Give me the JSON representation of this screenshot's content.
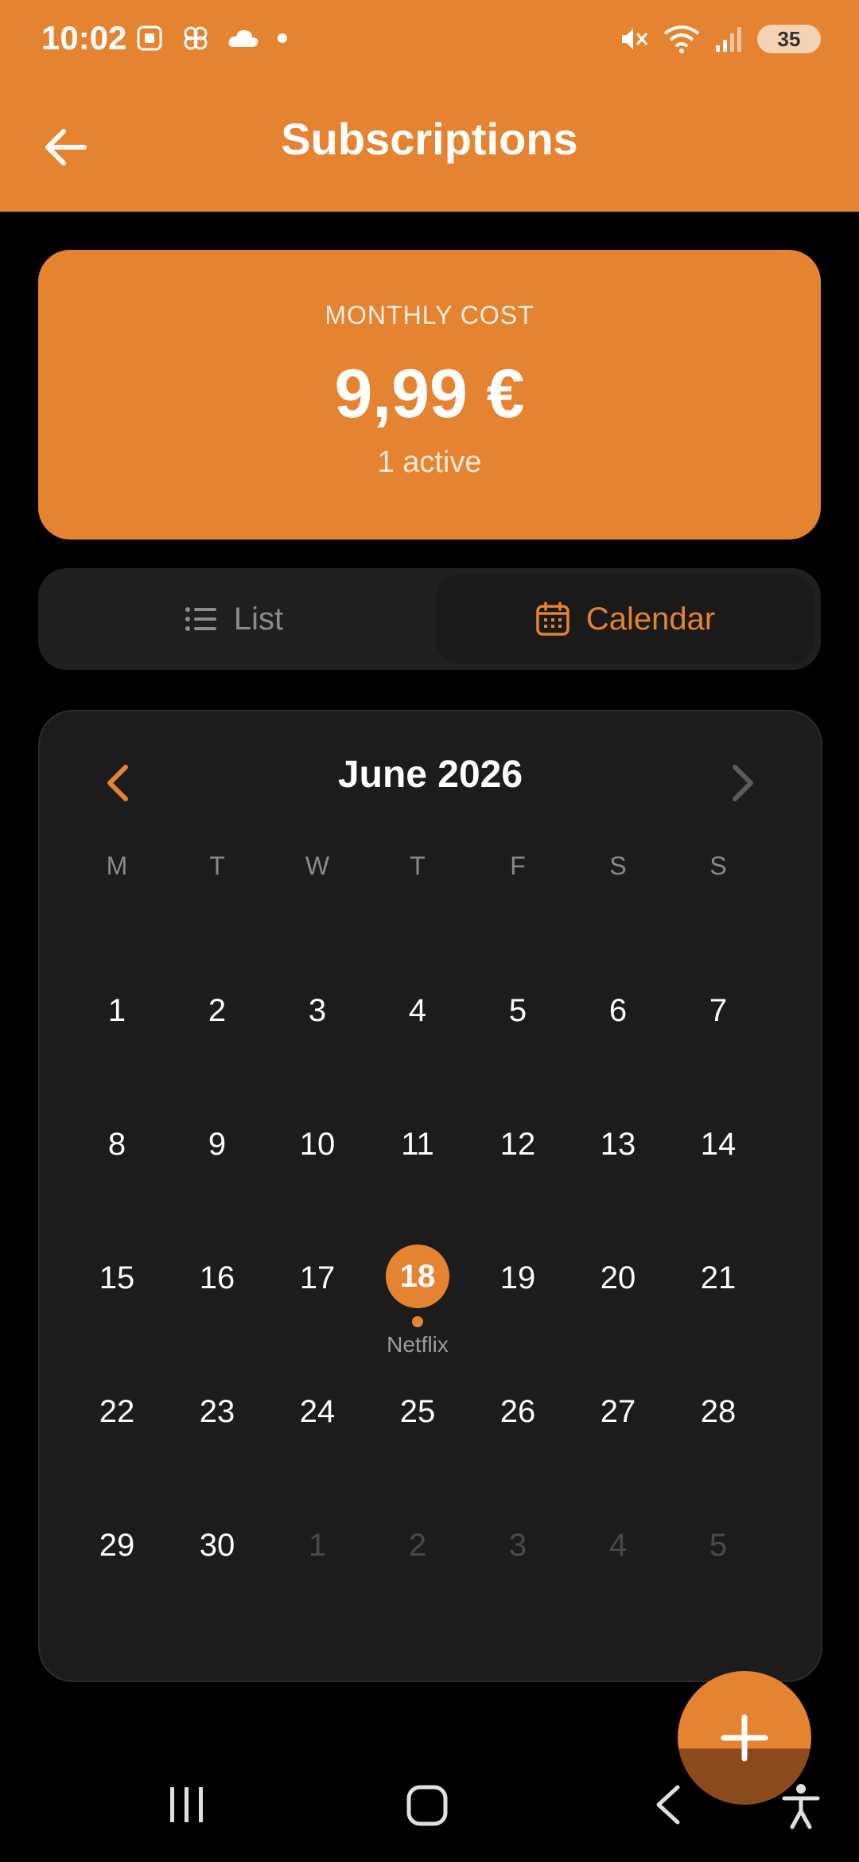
{
  "status_bar": {
    "time": "10:02",
    "battery_level": "35"
  },
  "header": {
    "title": "Subscriptions"
  },
  "summary": {
    "label": "MONTHLY COST",
    "amount": "9,99 €",
    "active_count": "1 active"
  },
  "view_toggle": {
    "list_label": "List",
    "calendar_label": "Calendar",
    "selected": "Calendar"
  },
  "calendar": {
    "month_title": "June 2026",
    "weekdays": [
      "M",
      "T",
      "W",
      "T",
      "F",
      "S",
      "S"
    ],
    "weeks": [
      [
        "1",
        "2",
        "3",
        "4",
        "5",
        "6",
        "7"
      ],
      [
        "8",
        "9",
        "10",
        "11",
        "12",
        "13",
        "14"
      ],
      [
        "15",
        "16",
        "17",
        "18",
        "19",
        "20",
        "21"
      ],
      [
        "22",
        "23",
        "24",
        "25",
        "26",
        "27",
        "28"
      ],
      [
        "29",
        "30",
        "1",
        "2",
        "3",
        "4",
        "5"
      ]
    ],
    "selected_day": "18",
    "event_label": "Netflix"
  },
  "colors": {
    "accent": "#E58330",
    "background": "#000000",
    "card": "#1C1C1D"
  },
  "icons": {
    "back": "arrow-left-icon",
    "list": "list-icon",
    "calendar": "calendar-icon",
    "add": "plus-icon"
  }
}
